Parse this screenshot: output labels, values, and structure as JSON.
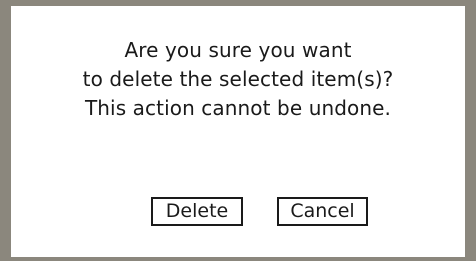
{
  "dialog": {
    "message_lines": [
      "Are you sure you want",
      "to delete the selected item(s)?",
      "This action cannot be undone."
    ],
    "buttons": {
      "delete_label": "Delete",
      "cancel_label": "Cancel"
    }
  },
  "colors": {
    "border": "#8b877d",
    "background": "#ffffff",
    "text": "#1a1a1a"
  }
}
